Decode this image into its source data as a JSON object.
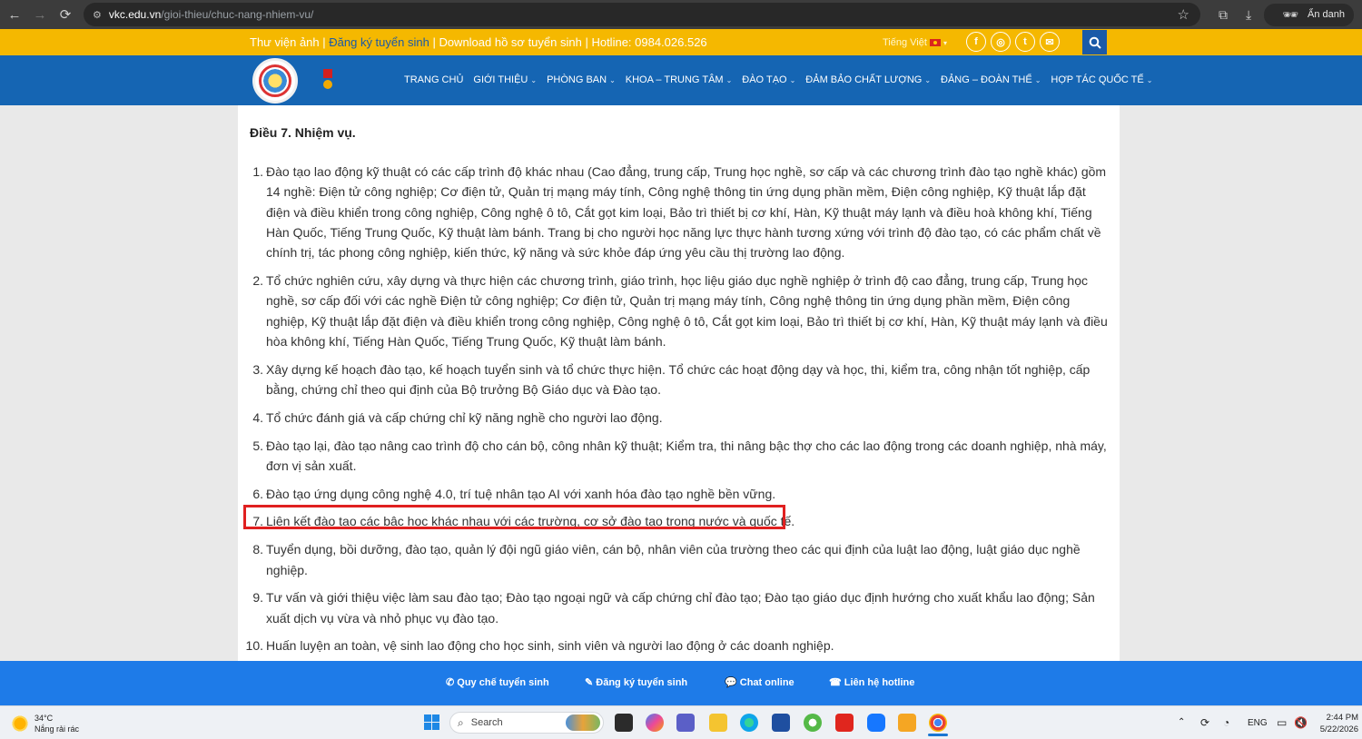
{
  "browser": {
    "url_host": "vkc.edu.vn",
    "url_path": "/gioi-thieu/chuc-nang-nhiem-vu/",
    "profile_label": "Ẩn danh"
  },
  "topbar": {
    "link_library": "Thư viện ảnh",
    "sep1": " | ",
    "link_register": "Đăng ký tuyển sinh",
    "sep2": " | ",
    "link_download": "Download hồ sơ tuyển sinh",
    "sep3": " | ",
    "hotline": "Hotline: 0984.026.526",
    "language": "Tiếng Việt"
  },
  "menu": {
    "items": [
      {
        "label": "TRANG CHỦ",
        "dropdown": false
      },
      {
        "label": "GIỚI THIỆU",
        "dropdown": true
      },
      {
        "label": "PHÒNG BAN",
        "dropdown": true
      },
      {
        "label": "KHOA – TRUNG TÂM",
        "dropdown": true
      },
      {
        "label": "ĐÀO TẠO",
        "dropdown": true
      },
      {
        "label": "ĐẢM BẢO CHẤT LƯỢNG",
        "dropdown": true
      },
      {
        "label": "ĐẢNG – ĐOÀN THỂ",
        "dropdown": true
      },
      {
        "label": "HỢP TÁC QUỐC TẾ",
        "dropdown": true
      }
    ]
  },
  "article": {
    "heading": "Điều 7. Nhiệm vụ.",
    "items": [
      {
        "num": "1.",
        "text": "Đào tạo lao động kỹ thuật có các cấp trình độ khác nhau (Cao đẳng, trung cấp, Trung học nghề, sơ cấp và các chương trình đào tạo nghề khác) gồm 14 nghề: Điện tử công nghiệp; Cơ điện tử, Quản trị mạng máy tính, Công nghệ thông tin ứng dụng phần mềm, Điện công nghiệp, Kỹ thuật lắp đặt điện và điều khiển trong công nghiệp, Công nghệ ô tô, Cắt gọt kim loại, Bảo trì thiết bị cơ khí, Hàn, Kỹ thuật máy lạnh và điều hoà không khí, Tiếng Hàn Quốc, Tiếng Trung Quốc, Kỹ thuật làm bánh. Trang bị cho người học năng lực thực hành tương xứng với trình độ đào tạo, có các phẩm chất về chính trị, tác phong công nghiệp, kiến thức, kỹ năng và sức khỏe đáp ứng yêu cầu thị trường lao động."
      },
      {
        "num": "2.",
        "text": "Tổ chức nghiên cứu, xây dựng và thực hiện các chương trình, giáo trình, học liệu giáo dục nghề nghiệp ở trình độ cao đẳng, trung cấp, Trung học nghề, sơ cấp đối với các nghề Điện tử công nghiệp; Cơ điện tử, Quản trị mạng máy tính, Công nghệ thông tin ứng dụng phần mềm, Điện công nghiệp, Kỹ thuật lắp đặt điện và điều khiển trong công nghiệp, Công nghệ ô tô, Cắt gọt kim loại, Bảo trì thiết bị cơ khí, Hàn, Kỹ thuật máy lạnh và điều hòa không khí, Tiếng Hàn Quốc, Tiếng Trung Quốc, Kỹ thuật làm bánh."
      },
      {
        "num": "3.",
        "text": "Xây dựng kế hoạch đào tạo, kế hoạch tuyển sinh và tổ chức thực hiện. Tổ chức các hoạt động dạy và học, thi, kiểm tra, công nhận tốt nghiệp, cấp bằng, chứng chỉ theo qui định của Bộ trưởng Bộ Giáo dục và Đào tạo."
      },
      {
        "num": "4.",
        "text": "Tổ chức đánh giá và cấp chứng chỉ kỹ năng nghề cho người lao động."
      },
      {
        "num": "5.",
        "text": "Đào tạo lại, đào tạo nâng cao trình độ cho cán bộ, công nhân kỹ thuật; Kiểm tra, thi nâng bậc thợ cho các lao động trong các doanh nghiệp, nhà máy, đơn vị sản xuất."
      },
      {
        "num": "6.",
        "text": "Đào tạo ứng dụng công nghệ 4.0, trí tuệ nhân tạo AI với xanh hóa đào tạo nghề bền vững."
      },
      {
        "num": "7.",
        "text": "Liên kết đào tạo các bậc học khác nhau với các trường, cơ sở đào tạo trong nước và quốc tế."
      },
      {
        "num": "8.",
        "text": "Tuyển dụng, bồi dưỡng, đào tạo, quản lý đội ngũ giáo viên, cán bộ, nhân viên của trường theo các qui định của luật lao động, luật giáo dục nghề nghiệp."
      },
      {
        "num": "9.",
        "text": "Tư vấn và giới thiệu việc làm sau đào tạo; Đào tạo ngoại ngữ và cấp chứng chỉ đào tạo; Đào tạo giáo dục định hướng cho xuất khẩu lao động; Sản xuất dịch vụ vừa và nhỏ phục vụ đào tạo."
      },
      {
        "num": "10.",
        "text": "Huấn luyện an toàn, vệ sinh lao động cho học sinh, sinh viên và người lao động ở các doanh nghiệp."
      }
    ]
  },
  "footer_bar": {
    "rules": "Quy chế tuyển sinh",
    "register": "Đăng ký tuyển sinh",
    "chat": "Chat online",
    "hotline": "Liên hệ hotline"
  },
  "taskbar": {
    "weather_temp": "34°C",
    "weather_desc": "Nắng rải rác",
    "search_label": "Search",
    "lang": "ENG",
    "time": "2:44 PM",
    "date": "5/22/2026"
  },
  "colors": {
    "top_bar": "#f5b800",
    "navbar": "#1565b3",
    "footer_bar": "#1e7be8",
    "highlight_border": "#e02020"
  }
}
